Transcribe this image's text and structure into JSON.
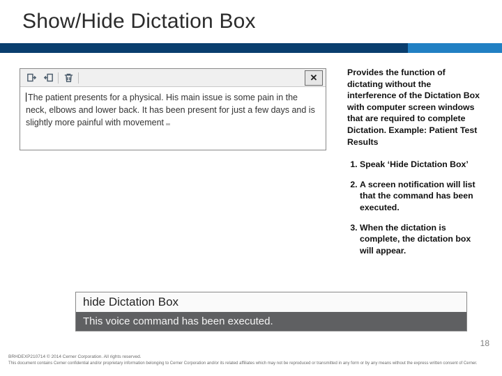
{
  "title": "Show/Hide Dictation Box",
  "dictation": {
    "text": "The patient presents for a physical.  His main issue is some pain in the neck, elbows and lower back.  It has been present for just a few days and is slightly more painful with movement",
    "close_label": "✕"
  },
  "description": "Provides the function of dictating without the interference of the Dictation Box with computer screen windows that are required to complete Dictation. Example: Patient Test Results",
  "steps": {
    "s1": "Speak ‘Hide Dictation Box’",
    "s2": "A screen notification will list that the command has been executed.",
    "s3": "When the dictation is complete, the dictation box will appear."
  },
  "notification": {
    "title": "hide Dictation Box",
    "body": "This voice command has been executed."
  },
  "page_number": "18",
  "footer": {
    "line1": "BRHDEXP210714    © 2014 Cerner Corporation.  All rights reserved.",
    "line2": "This document contains Cerner confidential and/or proprietary information belonging to Cerner Corporation and/or its related affiliates which may not be reproduced or transmitted in any form or by any means without the express written consent of Cerner."
  }
}
